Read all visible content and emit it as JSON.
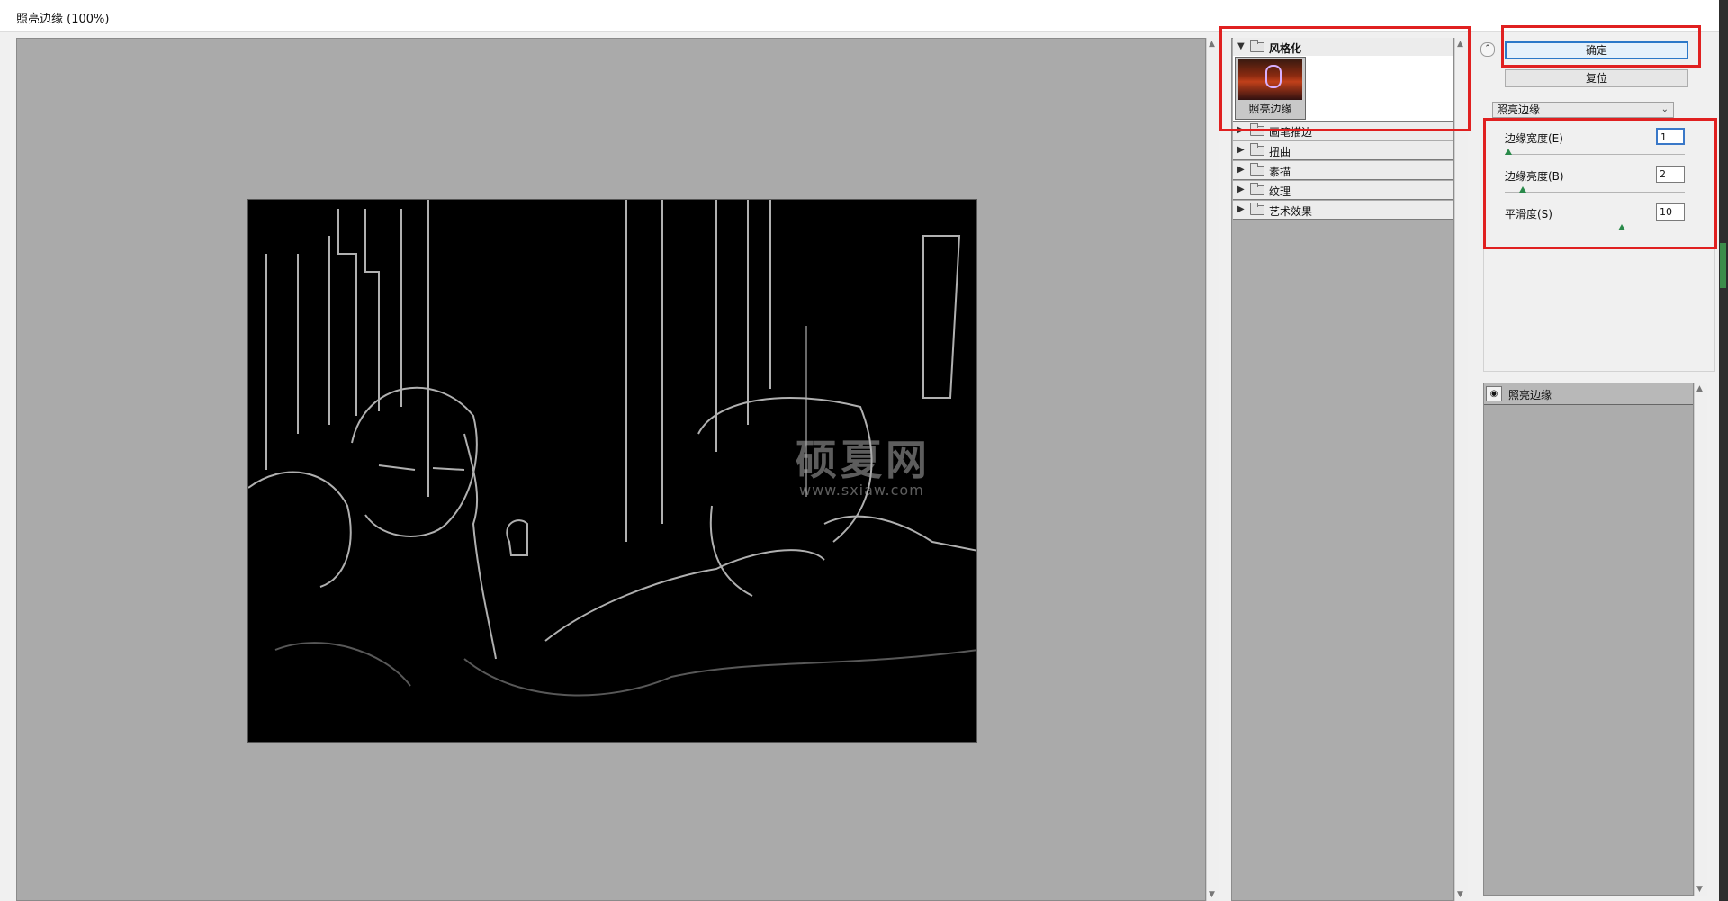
{
  "window": {
    "title": "照亮边缘 (100%)"
  },
  "preview": {
    "watermark_title": "硕夏网",
    "watermark_url": "www.sxiaw.com"
  },
  "gallery": {
    "categories": [
      {
        "label": "风格化",
        "expanded": true
      },
      {
        "label": "画笔描边",
        "expanded": false
      },
      {
        "label": "扭曲",
        "expanded": false
      },
      {
        "label": "素描",
        "expanded": false
      },
      {
        "label": "纹理",
        "expanded": false
      },
      {
        "label": "艺术效果",
        "expanded": false
      }
    ],
    "thumbnail": {
      "label": "照亮边缘"
    }
  },
  "settings": {
    "ok_label": "确定",
    "reset_label": "复位",
    "selected_filter": "照亮边缘",
    "params": [
      {
        "label": "边缘宽度(E)",
        "value": "1",
        "slider_fraction": 0.02
      },
      {
        "label": "边缘亮度(B)",
        "value": "2",
        "slider_fraction": 0.1
      },
      {
        "label": "平滑度(S)",
        "value": "10",
        "slider_fraction": 0.65
      }
    ]
  },
  "layers": {
    "items": [
      {
        "label": "照亮边缘",
        "visible": true
      }
    ]
  },
  "colors": {
    "annotation": "#e02020",
    "focus": "#2b78c8",
    "canvas_gray": "#aaaaaa"
  },
  "icons": [
    "folder-icon",
    "expand-triangle-icon",
    "collapse-triangle-icon",
    "eye-icon",
    "chevron-down-icon",
    "collapse-panel-icon"
  ]
}
